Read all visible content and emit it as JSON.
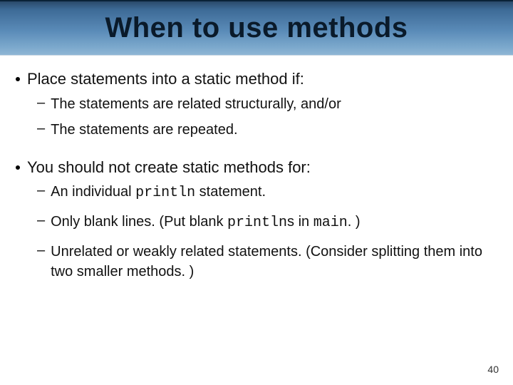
{
  "title": "When to use methods",
  "bullets": [
    {
      "text": "Place statements into a static method if:",
      "subs": [
        {
          "parts": [
            {
              "t": "The statements are related structurally, and/or"
            }
          ]
        },
        {
          "parts": [
            {
              "t": "The statements are repeated."
            }
          ]
        }
      ]
    },
    {
      "text": "You should not create static methods for:",
      "subs": [
        {
          "parts": [
            {
              "t": "An individual "
            },
            {
              "t": "println",
              "code": true
            },
            {
              "t": " statement."
            }
          ]
        },
        {
          "parts": [
            {
              "t": "Only blank lines. (Put blank "
            },
            {
              "t": "println",
              "code": true
            },
            {
              "t": "s in "
            },
            {
              "t": "main",
              "code": true
            },
            {
              "t": ". )"
            }
          ]
        },
        {
          "parts": [
            {
              "t": "Unrelated or weakly related statements. (Consider splitting them into two smaller methods. )"
            }
          ]
        }
      ]
    }
  ],
  "page_number": "40"
}
